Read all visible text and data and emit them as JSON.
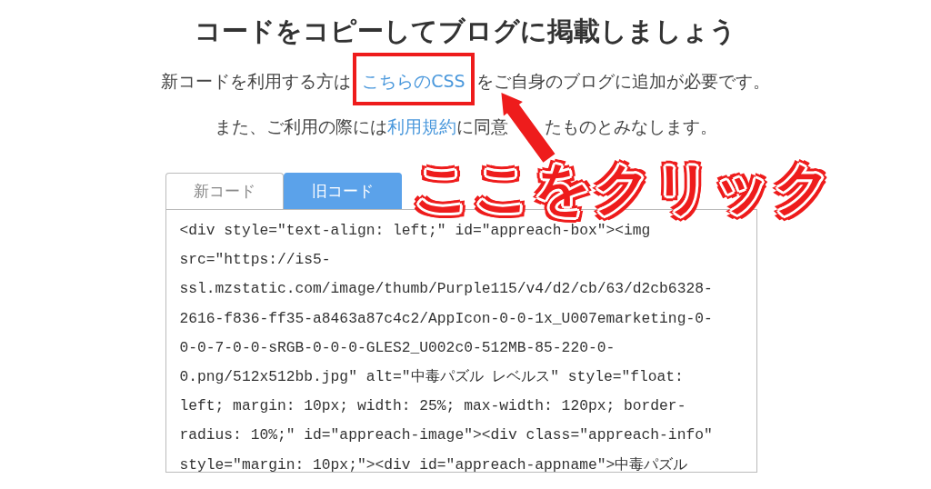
{
  "heading": "コードをコピーしてブログに掲載しましょう",
  "notice_1": {
    "before": "新コードを利用する方は",
    "link": "こちらのCSS",
    "after": "をご自身のブログに追加が必要です。"
  },
  "notice_2": {
    "before": "また、ご利用の際には",
    "link": "利用規約",
    "after_visible_1": "に同意",
    "after_visible_2": "たものとみなします。"
  },
  "tabs": [
    {
      "label": "新コード",
      "selected": false
    },
    {
      "label": "旧コード",
      "selected": true
    }
  ],
  "code_lines": [
    "<div style=\"text-align: left;\" id=\"appreach-box\"><img",
    "src=\"https://is5-",
    "ssl.mzstatic.com/image/thumb/Purple115/v4/d2/cb/63/d2cb6328-",
    "2616-f836-ff35-a8463a87c4c2/AppIcon-0-0-1x_U007emarketing-0-",
    "0-0-7-0-0-sRGB-0-0-0-GLES2_U002c0-512MB-85-220-0-",
    "0.png/512x512bb.jpg\" alt=\"中毒パズル レベルス\" style=\"float:",
    "left; margin: 10px; width: 25%; max-width: 120px; border-",
    "radius: 10%;\" id=\"appreach-image\"><div class=\"appreach-info\"",
    "style=\"margin: 10px;\"><div id=\"appreach-appname\">中毒パズル"
  ],
  "annotation": {
    "label": "ここをクリック"
  }
}
